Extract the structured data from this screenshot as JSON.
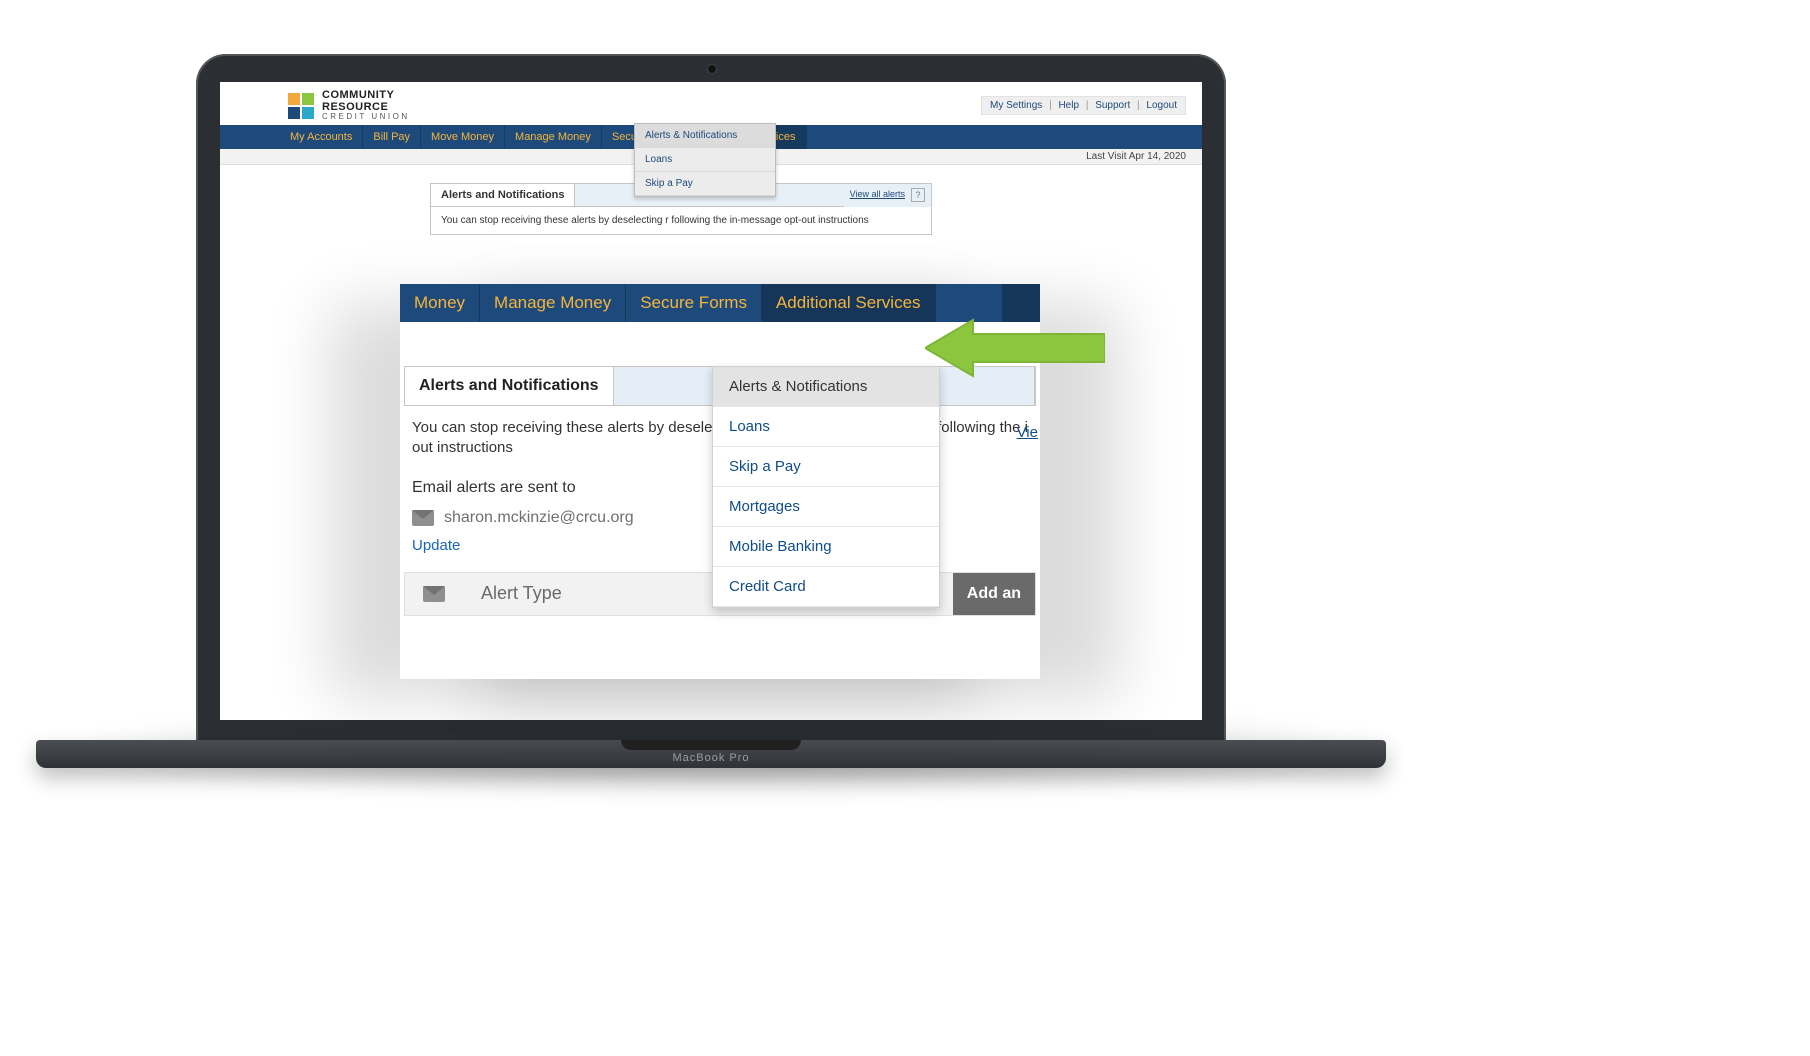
{
  "device": {
    "brand": "MacBook Pro"
  },
  "brand_logo": {
    "line1": "COMMUNITY",
    "line2": "RESOURCE",
    "line3": "CREDIT UNION"
  },
  "utility_nav": {
    "items": [
      "My Settings",
      "Help",
      "Support",
      "Logout"
    ],
    "separator": "|"
  },
  "last_visit": {
    "label": "Last Visit Apr 14, 2020"
  },
  "main_nav": {
    "items": [
      {
        "label": "My Accounts"
      },
      {
        "label": "Bill Pay"
      },
      {
        "label": "Move Money"
      },
      {
        "label": "Manage Money"
      },
      {
        "label": "Secure Forms"
      },
      {
        "label": "Additional Services",
        "active": true
      }
    ]
  },
  "additional_services_menu": {
    "items": [
      {
        "label": "Alerts & Notifications",
        "selected": true
      },
      {
        "label": "Loans"
      },
      {
        "label": "Skip a Pay"
      },
      {
        "label": "Mortgages"
      },
      {
        "label": "Mobile Banking"
      },
      {
        "label": "Credit Card"
      }
    ]
  },
  "alerts_panel": {
    "tab_title": "Alerts and Notifications",
    "view_all": "View all alerts",
    "help_mark": "?",
    "description_small": "You can stop receiving these alerts by deselecting                                                    r following the in-message opt-out instructions",
    "description_zoom_line1": "You can stop receiving these alerts by deselecting",
    "description_zoom_line2_right": "r following the i",
    "description_zoom_line3": "out instructions",
    "email_heading": "Email alerts are sent to",
    "email_value": "sharon.mckinzie@crcu.org",
    "update_link": "Update",
    "alert_type_header": "Alert Type",
    "add_button": "Add an"
  },
  "zoom_nav_fragment": {
    "items": [
      {
        "label": "Money"
      },
      {
        "label": "Manage Money"
      },
      {
        "label": "Secure Forms"
      },
      {
        "label": "Additional Services",
        "active": true
      }
    ],
    "view_link": "Vie"
  },
  "colors": {
    "nav_blue": "#1e4a7b",
    "nav_gold": "#f5b43c",
    "link_blue": "#0f4d8a",
    "arrow_green": "#8cc63f"
  }
}
